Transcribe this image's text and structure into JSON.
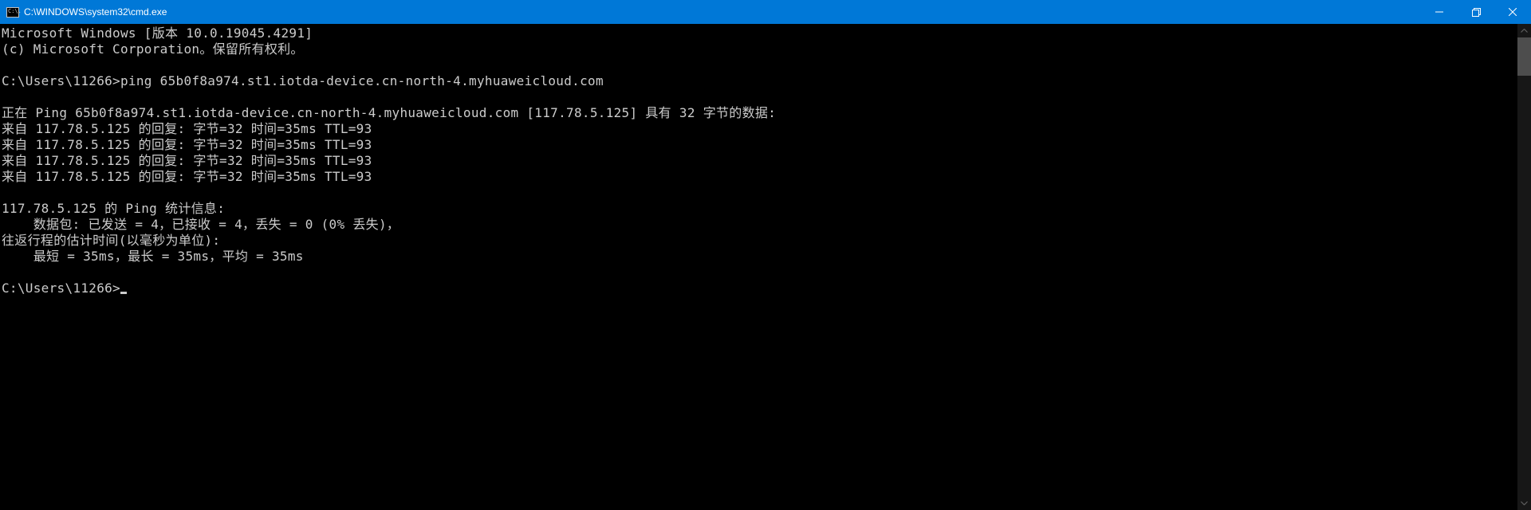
{
  "titlebar": {
    "icon_text": "C:\\.",
    "title": "C:\\WINDOWS\\system32\\cmd.exe"
  },
  "terminal": {
    "header_version": "Microsoft Windows [版本 10.0.19045.4291]",
    "header_copyright": "(c) Microsoft Corporation。保留所有权利。",
    "prompt1_path": "C:\\Users\\11266>",
    "prompt1_cmd": "ping 65b0f8a974.st1.iotda-device.cn-north-4.myhuaweicloud.com",
    "pinging_line": "正在 Ping 65b0f8a974.st1.iotda-device.cn-north-4.myhuaweicloud.com [117.78.5.125] 具有 32 字节的数据:",
    "reply1": "来自 117.78.5.125 的回复: 字节=32 时间=35ms TTL=93",
    "reply2": "来自 117.78.5.125 的回复: 字节=32 时间=35ms TTL=93",
    "reply3": "来自 117.78.5.125 的回复: 字节=32 时间=35ms TTL=93",
    "reply4": "来自 117.78.5.125 的回复: 字节=32 时间=35ms TTL=93",
    "stats_header": "117.78.5.125 的 Ping 统计信息:",
    "stats_packets": "    数据包: 已发送 = 4，已接收 = 4，丢失 = 0 (0% 丢失)，",
    "rtt_header": "往返行程的估计时间(以毫秒为单位):",
    "rtt_values": "    最短 = 35ms，最长 = 35ms，平均 = 35ms",
    "prompt2_path": "C:\\Users\\11266>"
  }
}
